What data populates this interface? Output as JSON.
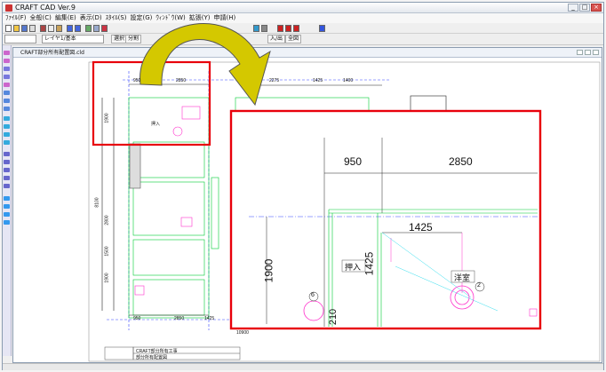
{
  "window": {
    "title": "CRAFT CAD Ver.9",
    "buttons": [
      "_",
      "□",
      "×"
    ]
  },
  "menu": [
    "ﾌｧｲﾙ(F)",
    "全般(C)",
    "編集(E)",
    "表示(D)",
    "ｽﾀｲﾙ(S)",
    "設定(G)",
    "ｳｨﾝﾄﾞｳ(W)",
    "拡張(Y)",
    "申請(H)"
  ],
  "toolbar2": {
    "layer_value": "レイヤ1/基本",
    "btn_a": "選択",
    "btn_b": "分割",
    "btn_c": "入/出",
    "btn_d": "全図"
  },
  "document": {
    "title": "CRAFT部分所有配置図.cld"
  },
  "plan": {
    "top_dims": [
      "950",
      "2850",
      "2275",
      "1425",
      "1400"
    ],
    "bottom_dims": [
      "950",
      "2850",
      "1425"
    ],
    "left_dims": [
      "1900",
      "8100",
      "2800",
      "1500",
      "1900"
    ],
    "room_label": "押入",
    "bottom_total": "10900",
    "title_block": [
      "CRAFT部分所有工事",
      "部分所有配置図"
    ]
  },
  "zoom": {
    "dim_top_a": "950",
    "dim_top_b": "2850",
    "dim_mid": "1425",
    "dim_vert_a": "1900",
    "dim_vert_b": "1425",
    "dim_bottom": "210",
    "room_closet": "押入",
    "room_bath": "洋室",
    "callout_6": "6",
    "callout_2": "2"
  },
  "colors": {
    "highlight": "#e8000b",
    "arrow": "#d4c800",
    "plan_green": "#00cc33",
    "plan_magenta": "#ff33cc",
    "plan_blue": "#3344ff"
  }
}
